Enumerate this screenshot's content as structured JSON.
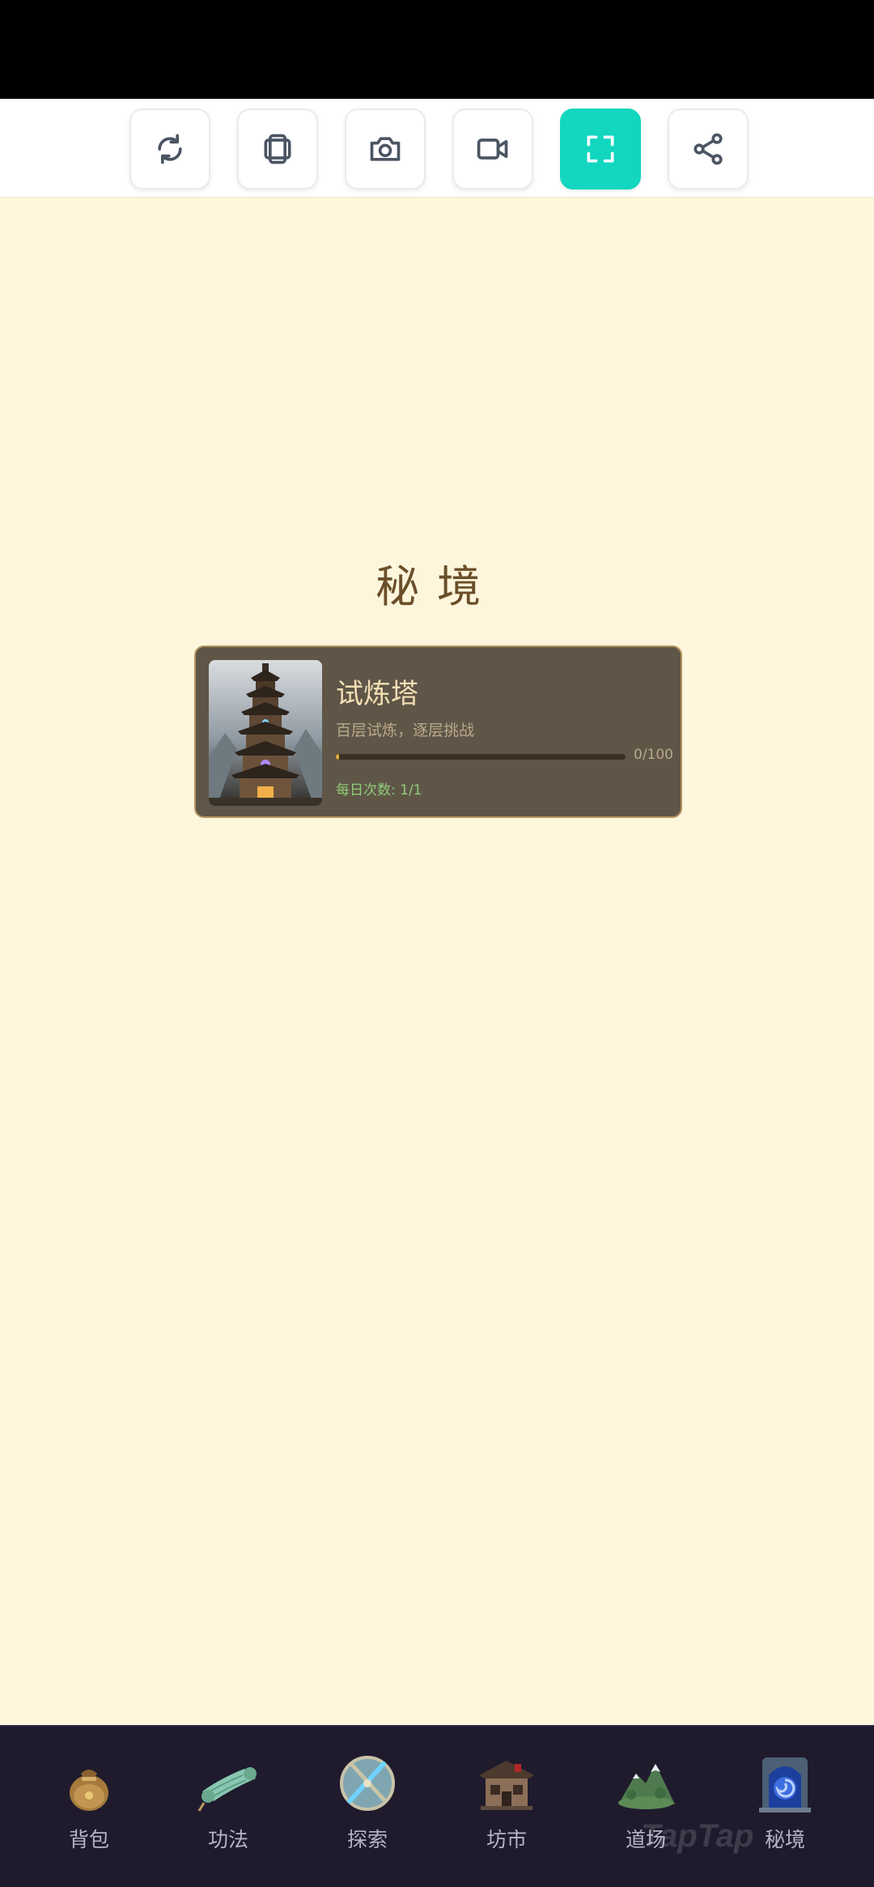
{
  "toolbar": {
    "buttons": [
      {
        "icon": "refresh-icon"
      },
      {
        "icon": "rotate-screen-icon"
      },
      {
        "icon": "camera-icon"
      },
      {
        "icon": "video-icon"
      },
      {
        "icon": "fullscreen-icon",
        "active": true
      },
      {
        "icon": "share-icon"
      }
    ]
  },
  "page": {
    "title": "秘境"
  },
  "trial": {
    "title": "试炼塔",
    "description": "百层试炼，逐层挑战",
    "progress_text": "0/100",
    "progress_current": 0,
    "progress_max": 100,
    "daily_limit": "每日次数: 1/1"
  },
  "nav": {
    "items": [
      {
        "label": "背包",
        "icon": "bag-icon"
      },
      {
        "label": "功法",
        "icon": "scroll-icon"
      },
      {
        "label": "探索",
        "icon": "crossed-swords-icon"
      },
      {
        "label": "坊市",
        "icon": "market-building-icon"
      },
      {
        "label": "道场",
        "icon": "mountain-icon"
      },
      {
        "label": "秘境",
        "icon": "portal-icon"
      }
    ]
  },
  "watermark": "TapTap"
}
